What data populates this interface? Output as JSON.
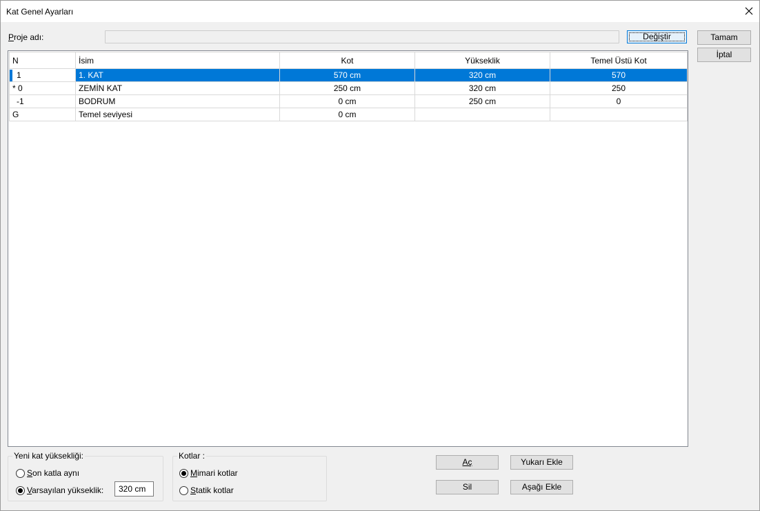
{
  "window": {
    "title": "Kat Genel Ayarları"
  },
  "project": {
    "label": "Proje adı:",
    "value": "",
    "change_button": "Değiştir"
  },
  "actions": {
    "ok": "Tamam",
    "cancel": "İptal"
  },
  "grid": {
    "columns": [
      "N",
      "İsim",
      "Kot",
      "Yükseklik",
      "Temel Üstü Kot"
    ],
    "rows": [
      {
        "n": "1",
        "name": "1. KAT",
        "kot": "570 cm",
        "height": "320 cm",
        "foundation_top": "570"
      },
      {
        "n": "* 0",
        "name": "ZEMİN KAT",
        "kot": "250 cm",
        "height": "320 cm",
        "foundation_top": "250"
      },
      {
        "n": "-1",
        "name": "BODRUM",
        "kot": "0 cm",
        "height": "250 cm",
        "foundation_top": "0"
      },
      {
        "n": "G",
        "name": "Temel seviyesi",
        "kot": "0 cm",
        "height": "",
        "foundation_top": ""
      }
    ],
    "selected_row": 0
  },
  "new_floor_height": {
    "title": "Yeni kat yüksekliği:",
    "option_same": "Son katla aynı",
    "option_default": "Varsayılan yükseklik:",
    "selected": "default",
    "default_value": "320 cm"
  },
  "elevations": {
    "title": "Kotlar :",
    "option_arch": "Mimari kotlar",
    "option_static": "Statik kotlar",
    "selected": "arch"
  },
  "row_buttons": {
    "open": "Aç",
    "delete": "Sil",
    "add_above": "Yukarı Ekle",
    "add_below": "Aşağı Ekle"
  },
  "colors": {
    "accent": "#0078d7",
    "button_face": "#e1e1e1",
    "window_bg": "#f0f0f0"
  }
}
